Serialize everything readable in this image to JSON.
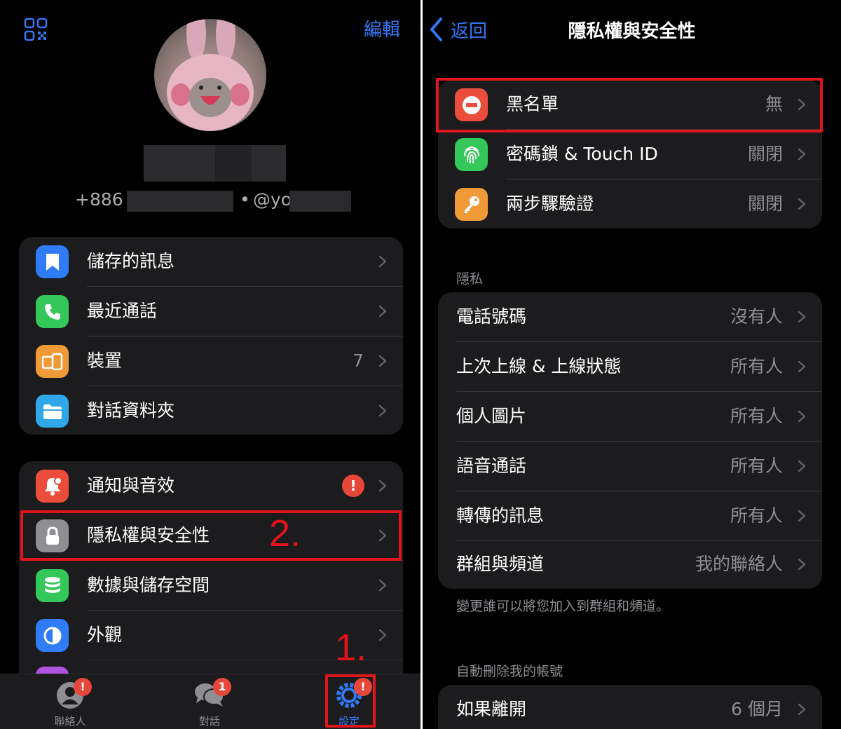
{
  "left": {
    "header": {
      "edit_label": "編輯",
      "qr_icon": "qr-code-icon"
    },
    "profile": {
      "phone_prefix": "+886",
      "separator": "•",
      "username_prefix": "@yo"
    },
    "group1": [
      {
        "label": "儲存的訊息",
        "icon": "bookmark-icon",
        "color": "#2f7cf6",
        "value": ""
      },
      {
        "label": "最近通話",
        "icon": "phone-icon",
        "color": "#34c759",
        "value": ""
      },
      {
        "label": "裝置",
        "icon": "devices-icon",
        "color": "#f09a37",
        "value": "7"
      },
      {
        "label": "對話資料夾",
        "icon": "folder-icon",
        "color": "#30a7e8",
        "value": ""
      }
    ],
    "group2": [
      {
        "label": "通知與音效",
        "icon": "bell-icon",
        "color": "#eb4d3d",
        "badge": "!"
      },
      {
        "label": "隱私權與安全性",
        "icon": "lock-icon",
        "color": "#8e8e93"
      },
      {
        "label": "數據與儲存空間",
        "icon": "database-icon",
        "color": "#34c759"
      },
      {
        "label": "外觀",
        "icon": "appearance-icon",
        "color": "#2f7cf6"
      }
    ],
    "tabbar": [
      {
        "label": "聯絡人",
        "icon": "contacts-icon",
        "badge": "!"
      },
      {
        "label": "對話",
        "icon": "chats-icon",
        "badge": "1"
      },
      {
        "label": "設定",
        "icon": "settings-icon",
        "badge": "!"
      }
    ],
    "annotations": {
      "step1": "1.",
      "step2": "2."
    }
  },
  "right": {
    "nav": {
      "back_label": "返回",
      "title": "隱私權與安全性"
    },
    "security": [
      {
        "label": "黑名單",
        "icon": "blocked-icon",
        "color": "#eb4d3d",
        "value": "無"
      },
      {
        "label": "密碼鎖 & Touch ID",
        "icon": "fingerprint-icon",
        "color": "#34c759",
        "value": "關閉"
      },
      {
        "label": "兩步驟驗證",
        "icon": "key-icon",
        "color": "#f09a37",
        "value": "關閉"
      }
    ],
    "privacy": {
      "header": "隱私",
      "items": [
        {
          "label": "電話號碼",
          "value": "沒有人"
        },
        {
          "label": "上次上線 & 上線狀態",
          "value": "所有人"
        },
        {
          "label": "個人圖片",
          "value": "所有人"
        },
        {
          "label": "語音通話",
          "value": "所有人"
        },
        {
          "label": "轉傳的訊息",
          "value": "所有人"
        },
        {
          "label": "群組與頻道",
          "value": "我的聯絡人"
        }
      ],
      "footer": "變更誰可以將您加入到群組和頻道。"
    },
    "auto_delete": {
      "header": "自動刪除我的帳號",
      "items": [
        {
          "label": "如果離開",
          "value": "6 個月"
        }
      ]
    }
  },
  "colors": {
    "accent": "#3478f6",
    "highlight": "#e0141b",
    "badge": "#e5483a"
  }
}
